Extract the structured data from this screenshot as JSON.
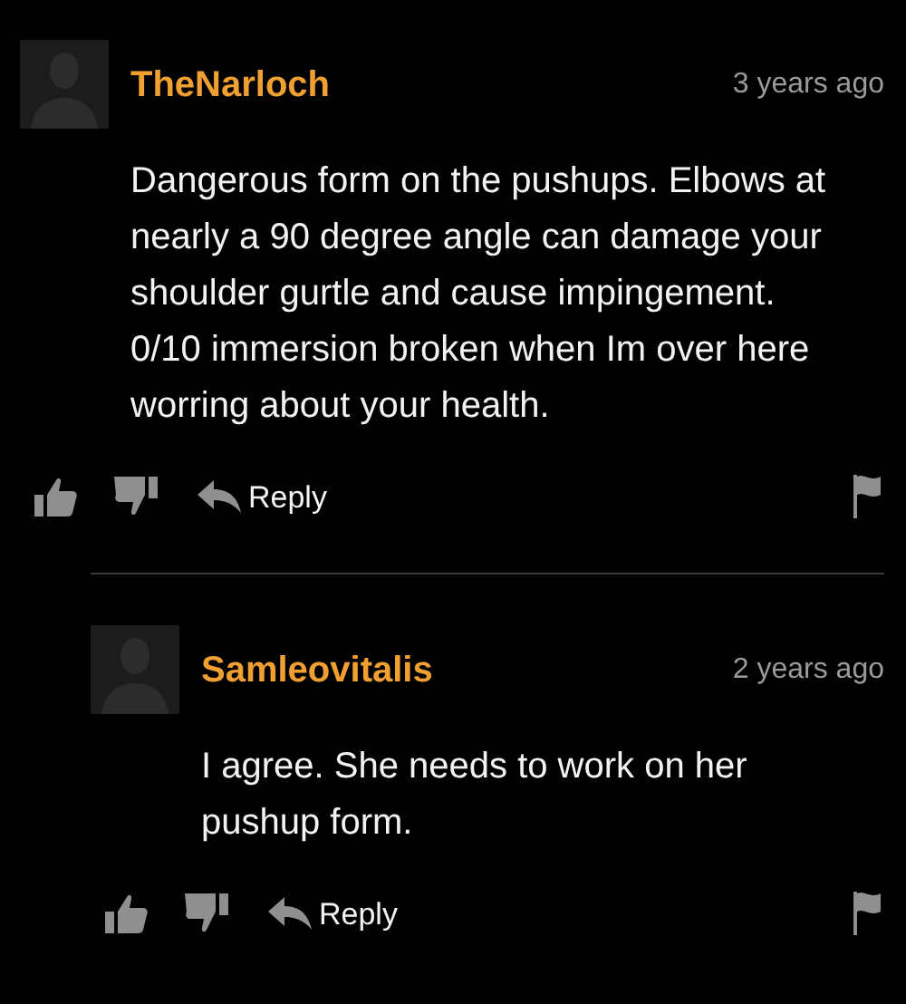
{
  "comments": [
    {
      "username": "TheNarloch",
      "time": "3 years ago",
      "body": "Dangerous form on the pushups. Elbows at nearly a 90 degree angle can damage your shoulder gurtle and cause impingement. 0/10 immersion broken when Im over here worring about your health.",
      "reply_label": "Reply",
      "children": [
        {
          "username": "Samleovitalis",
          "time": "2 years ago",
          "body": "I agree. She needs to work on her pushup form.",
          "reply_label": "Reply"
        }
      ]
    }
  ]
}
